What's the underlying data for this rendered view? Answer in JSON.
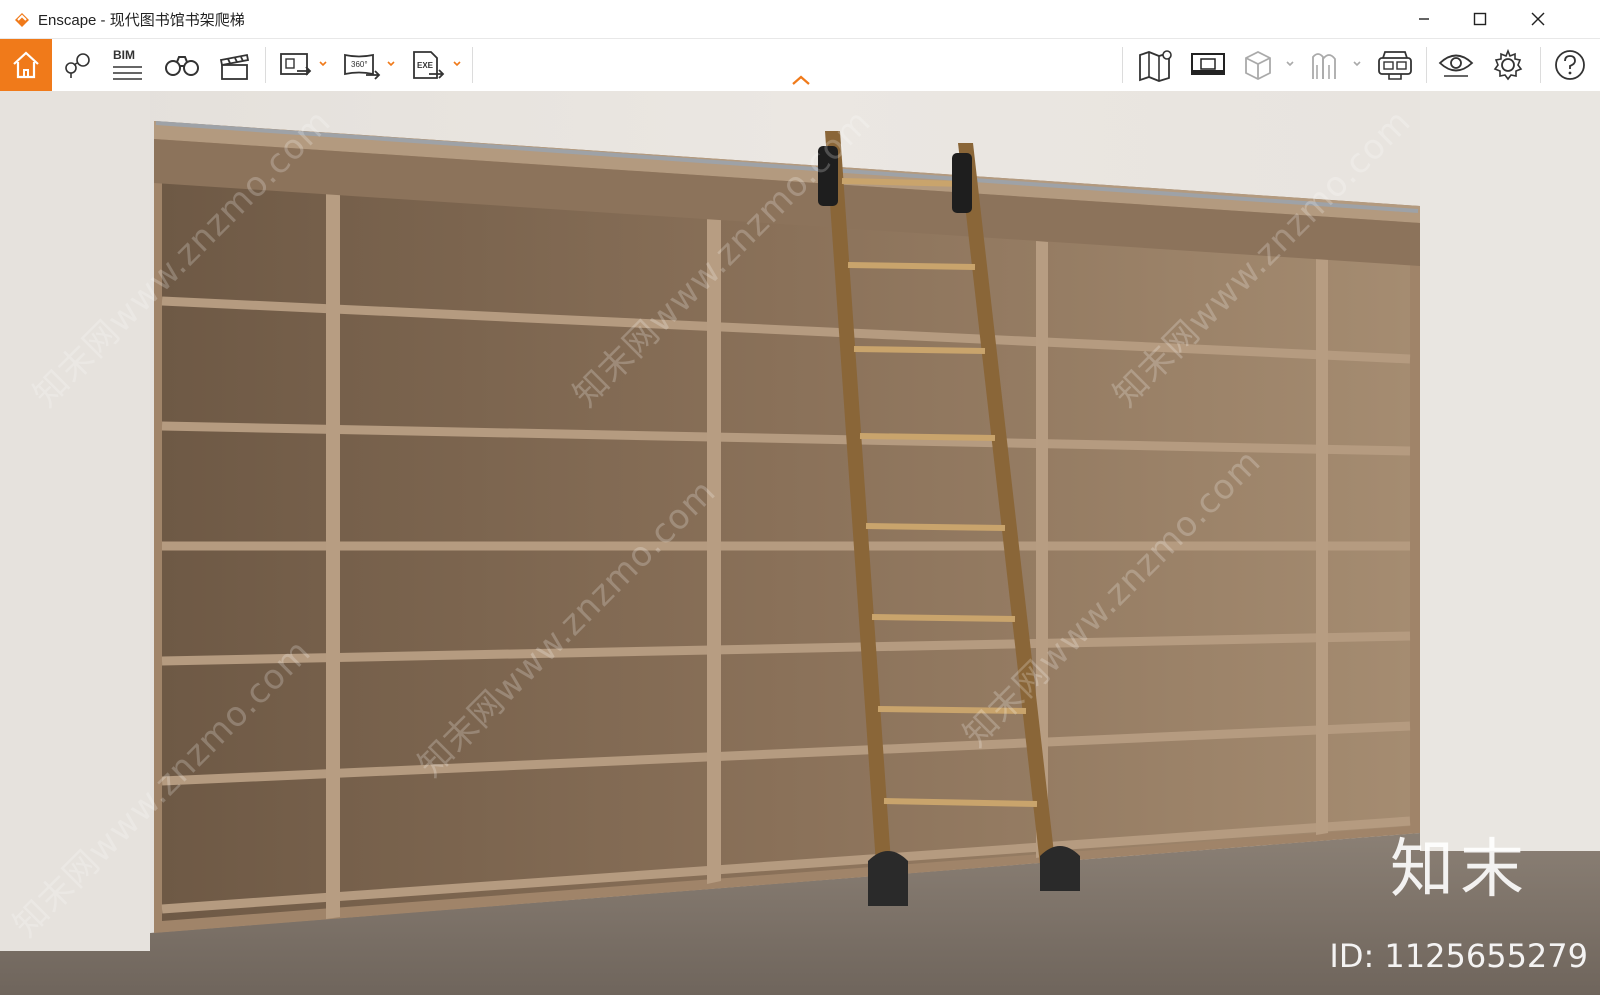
{
  "window": {
    "app_name": "Enscape",
    "title": "Enscape - 现代图书馆书架爬梯",
    "controls": [
      "minimize-icon",
      "maximize-icon",
      "close-icon"
    ]
  },
  "toolbar": {
    "accent_color": "#f07a1a",
    "left_tools": [
      {
        "name": "home",
        "icon": "home-icon"
      },
      {
        "name": "views",
        "icon": "map-pin-icon"
      },
      {
        "name": "bim",
        "label": "BIM",
        "icon": "bim-icon"
      },
      {
        "name": "asset-library",
        "icon": "binoculars-icon"
      },
      {
        "name": "video-editor",
        "icon": "clapperboard-icon"
      },
      {
        "name": "screenshot",
        "icon": "image-export-icon"
      },
      {
        "name": "panorama",
        "label": "360°",
        "icon": "panorama-icon"
      },
      {
        "name": "exe-export",
        "label": "EXE",
        "icon": "exe-export-icon"
      }
    ],
    "right_tools": [
      {
        "name": "map",
        "icon": "map-icon"
      },
      {
        "name": "batch-render",
        "icon": "batch-render-icon"
      },
      {
        "name": "cube",
        "icon": "cube-icon"
      },
      {
        "name": "material-editor",
        "icon": "material-icon"
      },
      {
        "name": "vr-headset",
        "icon": "vr-headset-icon"
      },
      {
        "name": "visual-settings",
        "icon": "eye-icon"
      },
      {
        "name": "general-settings",
        "icon": "gear-icon"
      },
      {
        "name": "help",
        "icon": "help-icon"
      }
    ],
    "collapse_icon": "chevron-up-icon"
  },
  "viewport": {
    "scene": "library bookshelf with rolling ladder",
    "watermark": "知末网www.znzmo.com",
    "brand": "知末",
    "id_label": "ID: 1125655279"
  }
}
